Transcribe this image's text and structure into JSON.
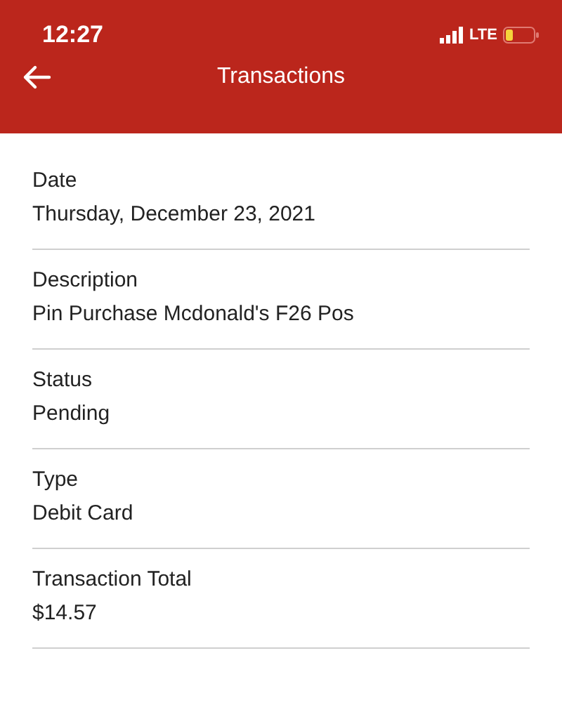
{
  "status_bar": {
    "time": "12:27",
    "network": "LTE"
  },
  "header": {
    "title": "Transactions"
  },
  "details": [
    {
      "label": "Date",
      "value": "Thursday, December 23, 2021"
    },
    {
      "label": "Description",
      "value": "Pin Purchase Mcdonald's F26 Pos"
    },
    {
      "label": "Status",
      "value": "Pending"
    },
    {
      "label": "Type",
      "value": "Debit Card"
    },
    {
      "label": "Transaction Total",
      "value": "$14.57"
    }
  ]
}
